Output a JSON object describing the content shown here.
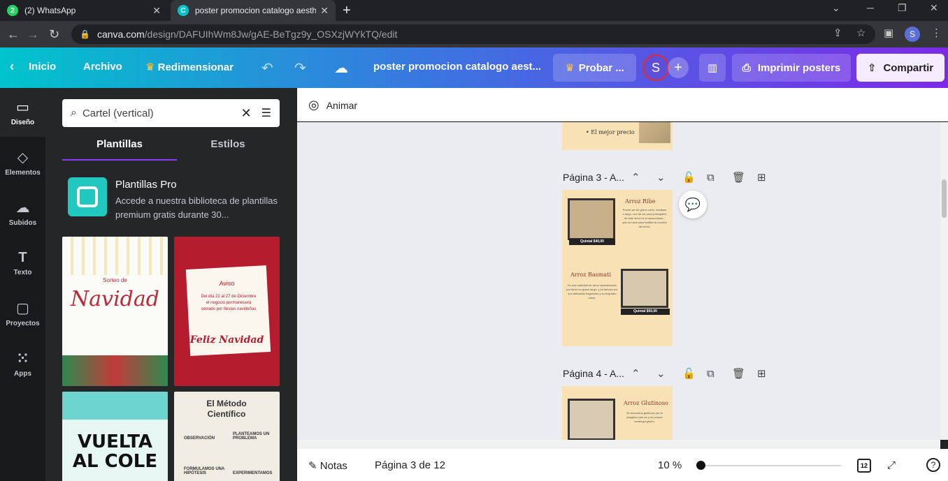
{
  "browser": {
    "tabs": [
      {
        "title": "(2) WhatsApp",
        "badge": "2",
        "active": false
      },
      {
        "title": "poster promocion catalogo aesthetic",
        "active": true
      }
    ],
    "url_host": "canva.com",
    "url_path": "/design/DAFUIhWm8Jw/gAE-BeTgz9y_OSXzjWYkTQ/edit",
    "profile_initial": "S"
  },
  "topbar": {
    "inicio": "Inicio",
    "archivo": "Archivo",
    "redimensionar": "Redimensionar",
    "doc_title": "poster promocion catalogo aest...",
    "probar": "Probar ...",
    "user_initial": "S",
    "imprimir": "Imprimir posters",
    "compartir": "Compartir"
  },
  "rail": [
    {
      "label": "Diseño",
      "icon": "layout-icon"
    },
    {
      "label": "Elementos",
      "icon": "shapes-icon"
    },
    {
      "label": "Subidos",
      "icon": "upload-icon"
    },
    {
      "label": "Texto",
      "icon": "text-icon"
    },
    {
      "label": "Proyectos",
      "icon": "folder-icon"
    },
    {
      "label": "Apps",
      "icon": "apps-icon"
    }
  ],
  "panel": {
    "search_value": "Cartel (vertical)",
    "tab_plantillas": "Plantillas",
    "tab_estilos": "Estilos",
    "pro_title": "Plantillas Pro",
    "pro_desc": "Accede a nuestra biblioteca de plantillas premium gratis durante 30...",
    "templates": [
      {
        "title": "Navidad",
        "subtitle": "Sorteo de"
      },
      {
        "title": "Feliz Navidad",
        "subtitle": "Aviso",
        "body": "Del día 22 al 27 de Diciembre el negocio permanecerá cerrado por fiestas navideñas"
      },
      {
        "title": "VUELTA AL COLE"
      },
      {
        "title": "El Método Científico",
        "items": [
          "OBSERVACIÓN",
          "PLANTEAMOS UN PROBLEMA",
          "FORMULAMOS UNA HIPÓTESIS",
          "EXPERIMENTAMOS"
        ]
      }
    ]
  },
  "toolbar": {
    "animar": "Animar"
  },
  "canvas": {
    "page2_tail": "• El mejor precio",
    "page3": {
      "label": "Página 3 - A...",
      "items": [
        {
          "name": "Arroz Ribe",
          "desc": "Puede ser de grano corto, mediano o largo, uno de los usos principales de este arroz es el sancochado , que se hace para facilitar la cocción del arroz.",
          "price": "Quintal $40,00"
        },
        {
          "name": "Arroz Basmati",
          "desc": "Es una variedad de arroz caracterizado por tener un grano largo, y es famoso por sus delicadas fragancias y su exquisito sabor.",
          "price": "Quintal $50,00"
        }
      ]
    },
    "page4": {
      "label": "Página 4 - A...",
      "items": [
        {
          "name": "Arroz Glutinoso",
          "desc": "Se denomina glutinoso por lo pegajoso que es y no porque contenga gluten."
        }
      ]
    }
  },
  "status": {
    "notas": "Notas",
    "page_info": "Página 3 de 12",
    "zoom": "10 %",
    "zoom_fraction": 0.0,
    "page_count": "12"
  }
}
